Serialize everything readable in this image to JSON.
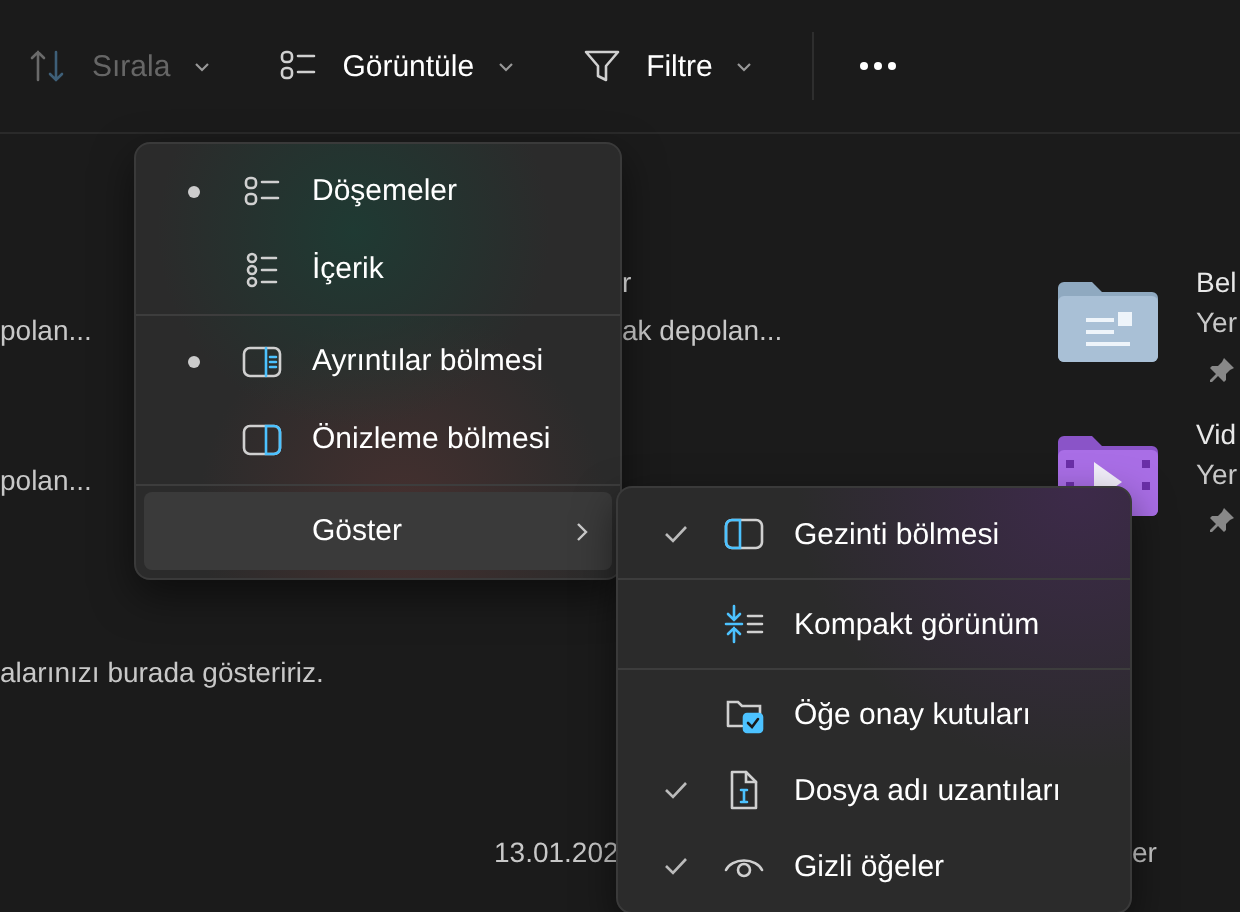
{
  "toolbar": {
    "items": [
      {
        "label": "Sırala",
        "disabled": true
      },
      {
        "label": "Görüntüle",
        "disabled": false
      },
      {
        "label": "Filtre",
        "disabled": false
      }
    ]
  },
  "background": {
    "column_1": [
      {
        "detail": "polan..."
      },
      {
        "detail": "polan..."
      }
    ],
    "column_2": [
      {
        "name": "r",
        "detail": "ak depolan..."
      }
    ],
    "column_3": [
      {
        "name": "Bel",
        "detail": "Yer",
        "kind": "documents",
        "pinned": true
      },
      {
        "name": "Vid",
        "detail": "Yer",
        "kind": "videos",
        "pinned": true
      }
    ],
    "empty_message": "alarınızı burada gösteririz.",
    "row_date": "13.01.202",
    "row_end": "er"
  },
  "view_menu": {
    "groups": [
      [
        {
          "kind": "option",
          "label": "Döşemeler",
          "selected": true,
          "highlighted": false
        },
        {
          "kind": "option",
          "label": "İçerik",
          "selected": false,
          "highlighted": false
        }
      ],
      [
        {
          "kind": "option",
          "label": "Ayrıntılar bölmesi",
          "selected": true,
          "highlighted": false
        },
        {
          "kind": "option",
          "label": "Önizleme bölmesi",
          "selected": false,
          "highlighted": false
        }
      ],
      [
        {
          "kind": "submenu",
          "label": "Göster",
          "highlighted": true
        }
      ]
    ]
  },
  "show_submenu": {
    "groups": [
      [
        {
          "kind": "toggle",
          "label": "Gezinti bölmesi",
          "checked": true
        }
      ],
      [
        {
          "kind": "toggle",
          "label": "Kompakt görünüm",
          "checked": false
        }
      ],
      [
        {
          "kind": "toggle",
          "label": "Öğe onay kutuları",
          "checked": false
        },
        {
          "kind": "toggle",
          "label": "Dosya adı uzantıları",
          "checked": true
        },
        {
          "kind": "toggle",
          "label": "Gizli öğeler",
          "checked": true
        }
      ]
    ]
  }
}
